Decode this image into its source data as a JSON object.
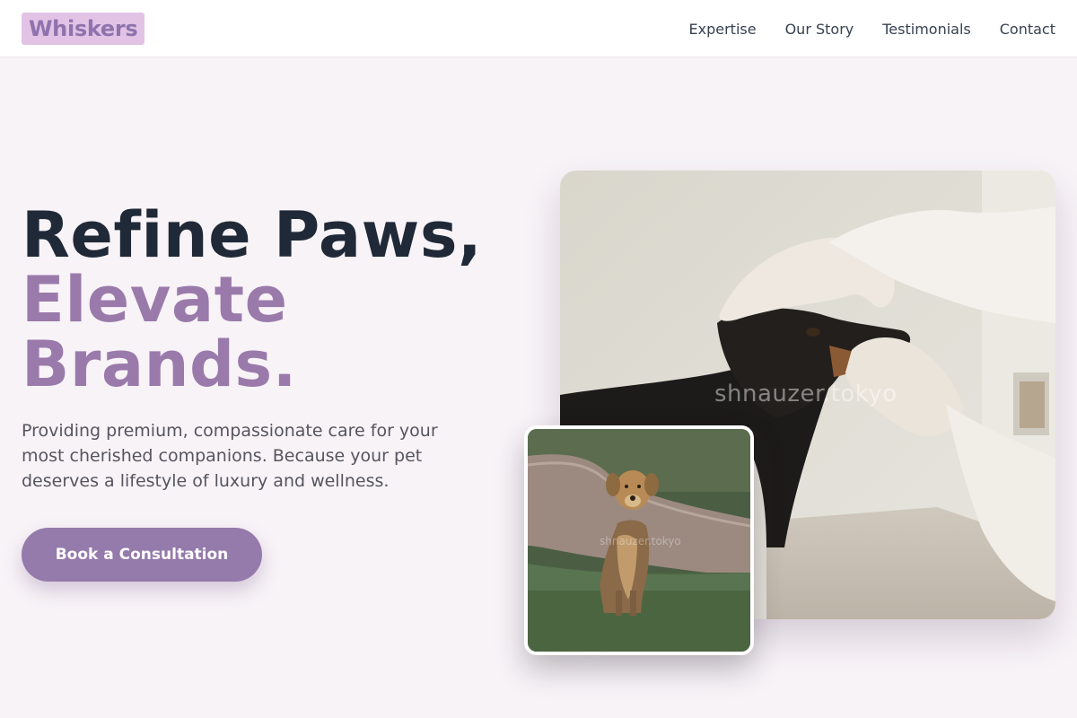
{
  "header": {
    "logo": "Whiskers",
    "nav": [
      {
        "label": "Expertise"
      },
      {
        "label": "Our Story"
      },
      {
        "label": "Testimonials"
      },
      {
        "label": "Contact"
      }
    ]
  },
  "hero": {
    "headline_line1": "Refine Paws,",
    "headline_line2": "Elevate Brands.",
    "subtext": "Providing premium, compassionate care for your most cherished companions. Because your pet deserves a lifestyle of luxury and wellness.",
    "cta_label": "Book a Consultation"
  },
  "images": {
    "main": {
      "watermark": "shnauzer.tokyo"
    },
    "secondary": {
      "watermark": "shnauzer.tokyo"
    }
  },
  "colors": {
    "accent": "#957aac",
    "logo_bg": "#e2c3e6",
    "page_bg": "#f8f3f7",
    "text_dark": "#1f2937"
  }
}
